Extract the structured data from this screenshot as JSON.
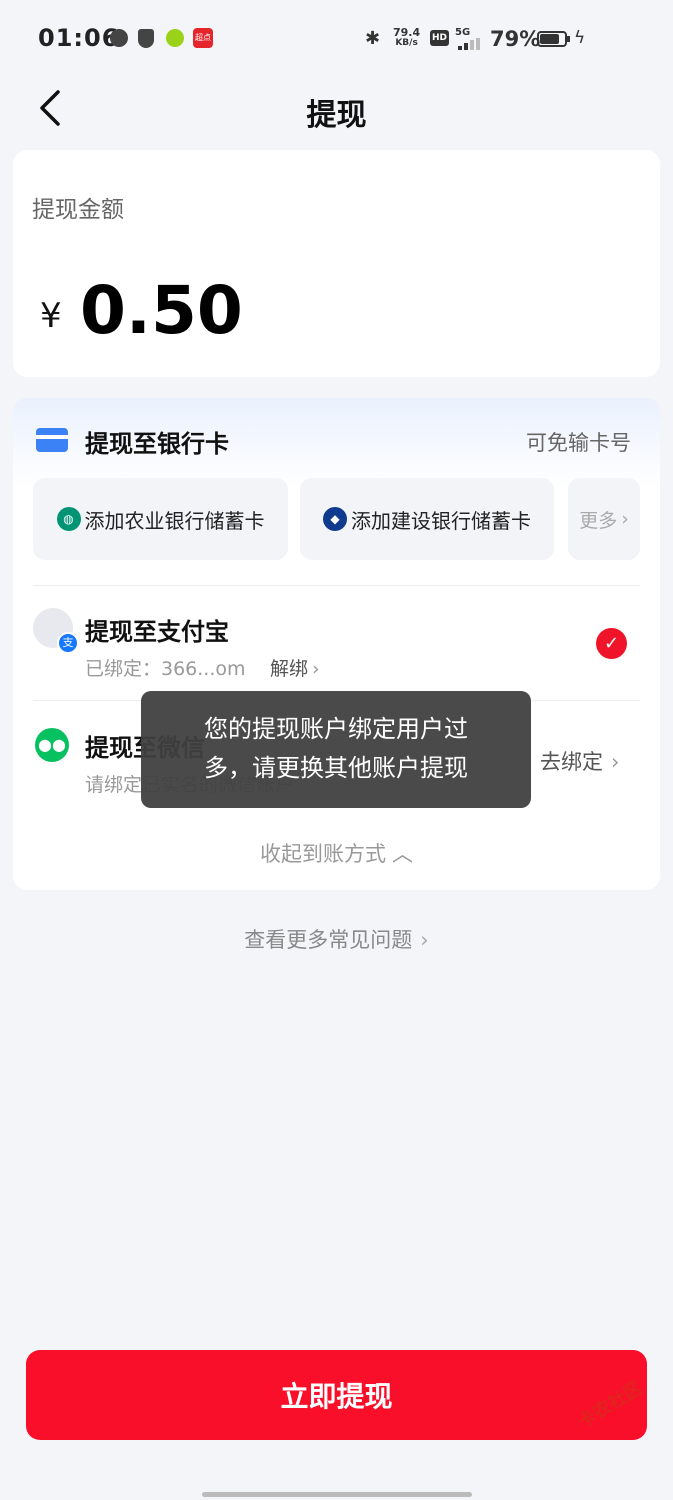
{
  "status_bar": {
    "time": "01:06",
    "net_speed_value": "79.4",
    "net_speed_unit": "KB/s",
    "hd_label": "HD",
    "network": "5G",
    "battery_percent": "79%",
    "battery_level": 0.79,
    "app_badge": "超点"
  },
  "header": {
    "title": "提现"
  },
  "amount_card": {
    "label": "提现金额",
    "currency": "¥",
    "amount": "0.50"
  },
  "bank_section": {
    "title": "提现至银行卡",
    "note": "可免输卡号",
    "buttons": [
      {
        "label": "添加农业银行储蓄卡"
      },
      {
        "label": "添加建设银行储蓄卡"
      },
      {
        "label": "更多"
      }
    ]
  },
  "alipay": {
    "title": "提现至支付宝",
    "bound_label": "已绑定：366...om",
    "unbind": "解绑",
    "badge": "支",
    "selected": true
  },
  "wechat": {
    "title": "提现至微信",
    "sub": "请绑定已实名的微信账户",
    "action": "去绑定"
  },
  "collapse_label": "收起到账方式",
  "faq_link": "查看更多常见问题",
  "toast": {
    "line1": "您的提现账户绑定用户过",
    "line2": "多，请更换其他账户提现"
  },
  "submit_button": "立即提现",
  "watermark": "卡农社区",
  "colors": {
    "accent_red": "#fa0f2a",
    "page_bg": "#f4f5f9",
    "bank_card_blue": "#3b82f6",
    "wechat_green": "#07c160",
    "alipay_blue": "#1677ff"
  }
}
